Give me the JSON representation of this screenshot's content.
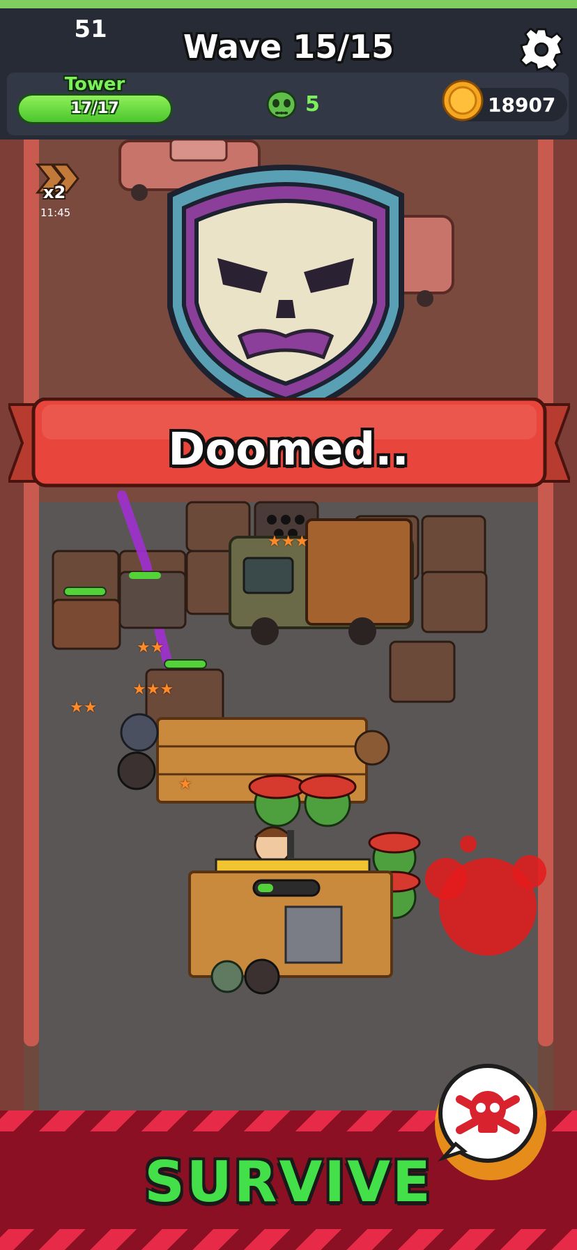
{
  "hud": {
    "counter": "51",
    "wave": "Wave 15/15",
    "tower": {
      "title": "Tower",
      "value": "17/17",
      "fill": 1.0
    },
    "zombies": "5",
    "coins": "18907"
  },
  "speed": {
    "multiplier": "x2",
    "time": "11:45"
  },
  "status": {
    "banner_text": "Doomed.."
  },
  "units": {
    "stars_row1": "★★★",
    "stars_unit_a": "★★",
    "stars_unit_b": "★★★",
    "stars_unit_c": "★★",
    "stars_unit_d": "★"
  },
  "bottom": {
    "label": "SURVIVE"
  },
  "colors": {
    "accent_green": "#44e04a",
    "banner_red": "#e8453c",
    "bottom_red": "#8c1024"
  }
}
